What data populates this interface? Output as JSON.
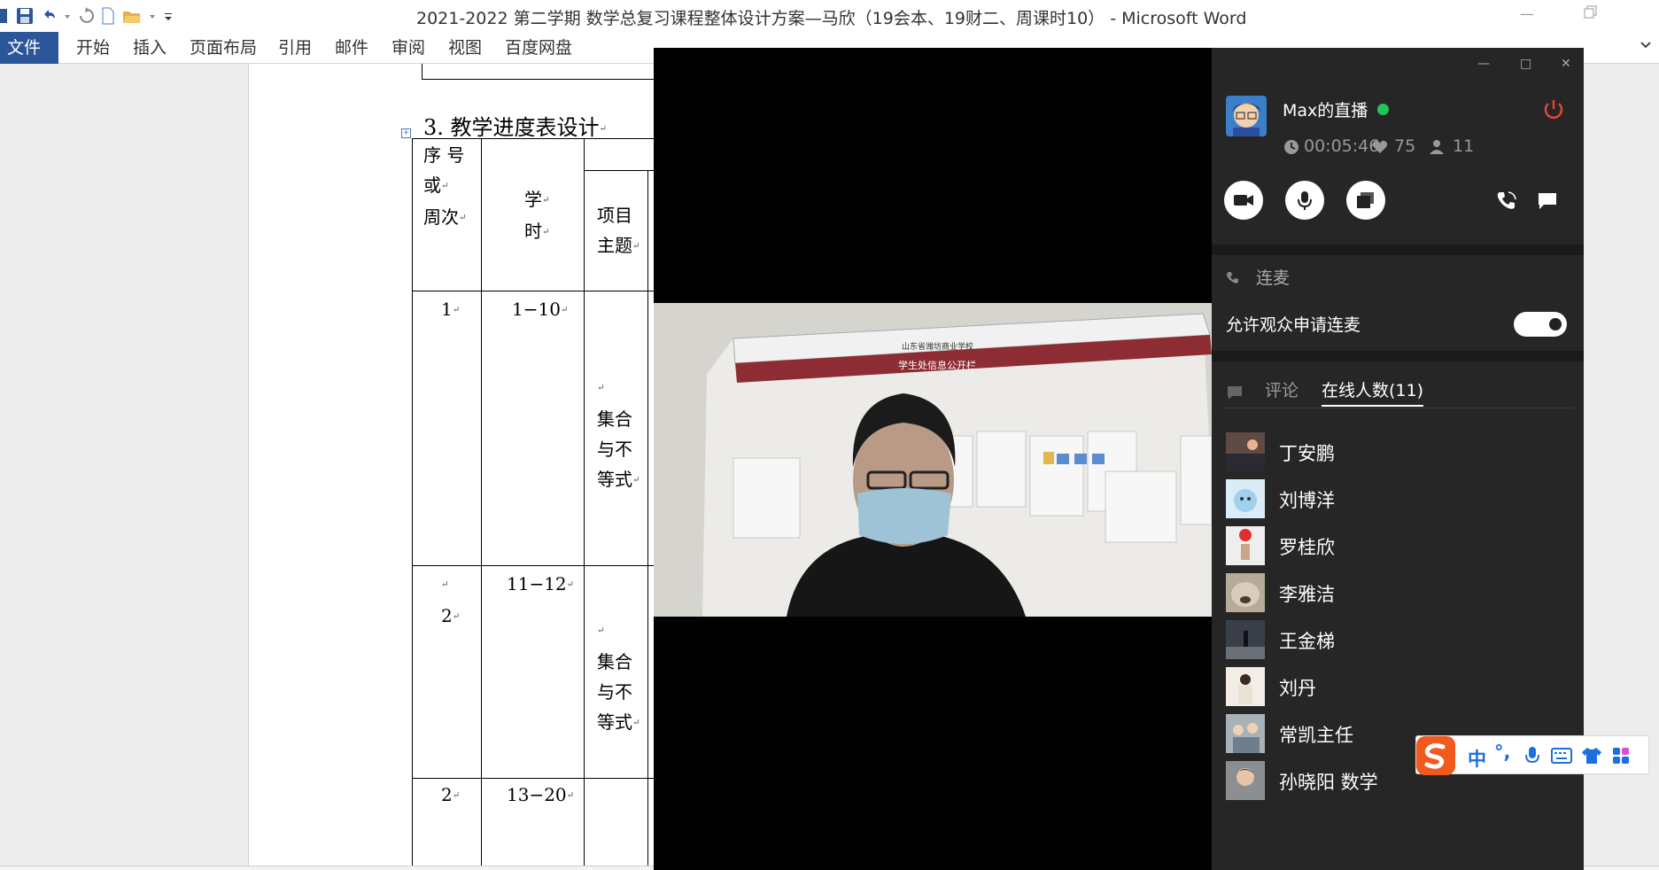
{
  "word": {
    "title": "2021-2022 第二学期 数学总复习课程整体设计方案—马欣（19会本、19财二、周课时10） - Microsoft Word",
    "ribbon_tabs": [
      "文件",
      "开始",
      "插入",
      "页面布局",
      "引用",
      "邮件",
      "审阅",
      "视图",
      "百度网盘"
    ],
    "heading": "3. 教学进度表设计",
    "table": {
      "headers": {
        "col1": [
          "序 号",
          "或",
          "周次"
        ],
        "col2": [
          "学",
          "时"
        ],
        "col3": [
          "项目",
          "主题"
        ]
      },
      "rows": [
        {
          "week": "1",
          "hours": "1−10",
          "topic": [
            "集合",
            "与不",
            "等式"
          ]
        },
        {
          "week": "2",
          "hours": "11−12",
          "topic": [
            "集合",
            "与不",
            "等式"
          ]
        },
        {
          "week": "2",
          "hours": "13−20",
          "topic": []
        }
      ]
    },
    "paragraph_mark": "↵"
  },
  "video": {
    "board_line1": "山东省潍坊商业学校",
    "board_line2": "学生处信息公开栏"
  },
  "live": {
    "host_name": "Max的直播",
    "duration": "00:05:46",
    "likes": "75",
    "viewers": "11",
    "lianmai_label": "连麦",
    "allow_label": "允许观众申请连麦",
    "allow_enabled": true,
    "tab_comment": "评论",
    "tab_online": "在线人数(11)",
    "members": [
      "丁安鹏",
      "刘博洋",
      "罗桂欣",
      "李雅洁",
      "王金梯",
      "刘丹",
      "常凯主任",
      "孙晓阳 数学"
    ]
  },
  "ime": {
    "mode": "中",
    "punct": "°,"
  },
  "colors": {
    "word_blue": "#2b579a",
    "panel_bg": "#262626",
    "live_green": "#22c45a",
    "power_red": "#e5453a",
    "ime_blue": "#1d6fe0",
    "ime_orange": "#f05a1e"
  }
}
